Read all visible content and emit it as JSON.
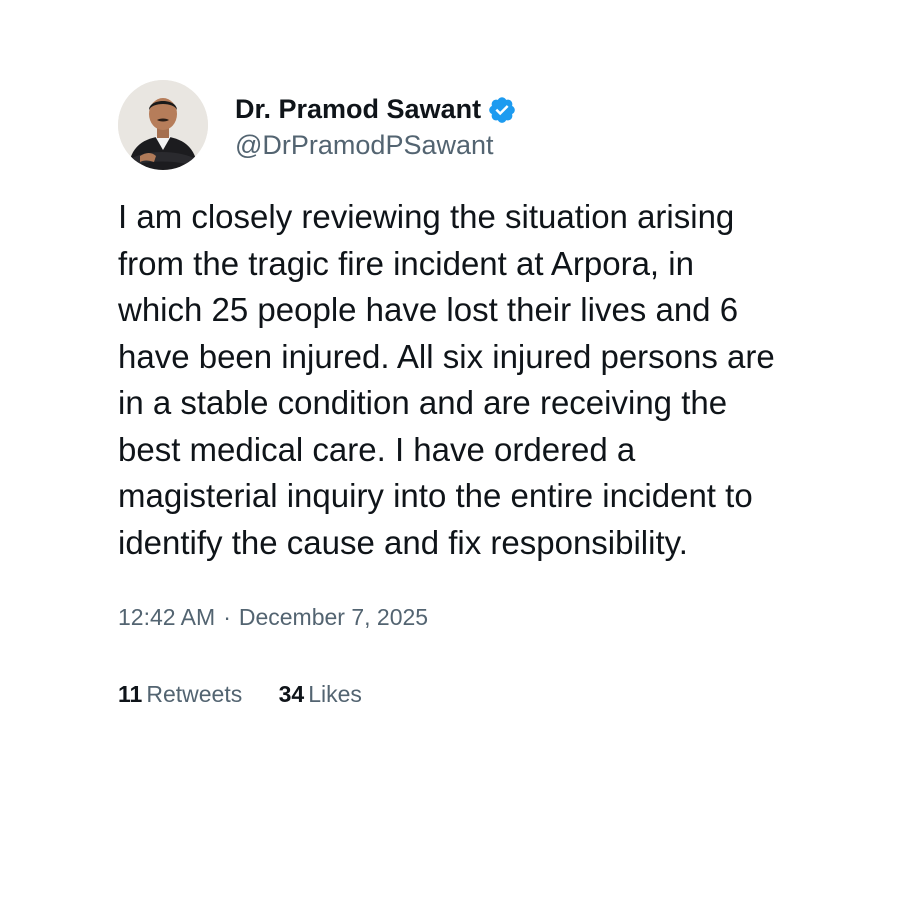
{
  "author": {
    "name": "Dr. Pramod Sawant",
    "handle": "@DrPramodPSawant",
    "verified": true,
    "avatar_icon": "profile-photo"
  },
  "tweet": {
    "text": "I am closely reviewing the situation arising from the tragic fire incident at Arpora, in which 25 people have lost their lives and 6 have been injured. All six injured persons are in a stable condition and are receiving the best medical care. I have ordered a magisterial inquiry into the entire incident to identify the cause and fix responsibility.",
    "time": "12:42 AM",
    "separator": "·",
    "date": "December 7, 2025"
  },
  "stats": {
    "retweets_count": "11",
    "retweets_label": "Retweets",
    "likes_count": "34",
    "likes_label": "Likes"
  },
  "colors": {
    "text": "#0f1419",
    "secondary": "#536471",
    "verified": "#1d9bf0"
  }
}
